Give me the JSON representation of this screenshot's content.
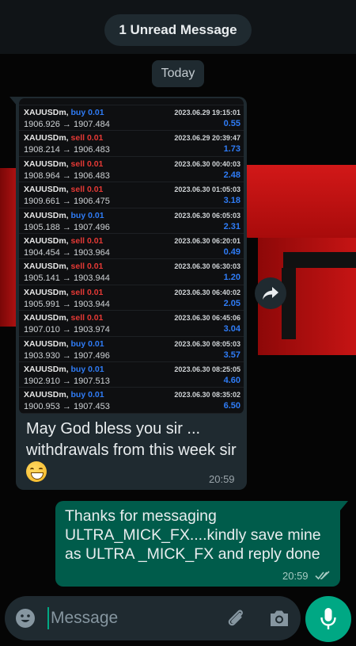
{
  "banner": {
    "unread": "1 Unread Message",
    "date_chip": "Today"
  },
  "incoming": {
    "trades": [
      {
        "symbol": "XAUUSDm,",
        "direction": "buy",
        "lot": "0.01",
        "prices": "1906.926 → 1907.484",
        "date": "2023.06.29 19:15:01",
        "profit": "0.55"
      },
      {
        "symbol": "XAUUSDm,",
        "direction": "sell",
        "lot": "0.01",
        "prices": "1908.214 → 1906.483",
        "date": "2023.06.29 20:39:47",
        "profit": "1.73"
      },
      {
        "symbol": "XAUUSDm,",
        "direction": "sell",
        "lot": "0.01",
        "prices": "1908.964 → 1906.483",
        "date": "2023.06.30 00:40:03",
        "profit": "2.48"
      },
      {
        "symbol": "XAUUSDm,",
        "direction": "sell",
        "lot": "0.01",
        "prices": "1909.661 → 1906.475",
        "date": "2023.06.30 01:05:03",
        "profit": "3.18"
      },
      {
        "symbol": "XAUUSDm,",
        "direction": "buy",
        "lot": "0.01",
        "prices": "1905.188 → 1907.496",
        "date": "2023.06.30 06:05:03",
        "profit": "2.31"
      },
      {
        "symbol": "XAUUSDm,",
        "direction": "sell",
        "lot": "0.01",
        "prices": "1904.454 → 1903.964",
        "date": "2023.06.30 06:20:01",
        "profit": "0.49"
      },
      {
        "symbol": "XAUUSDm,",
        "direction": "sell",
        "lot": "0.01",
        "prices": "1905.141 → 1903.944",
        "date": "2023.06.30 06:30:03",
        "profit": "1.20"
      },
      {
        "symbol": "XAUUSDm,",
        "direction": "sell",
        "lot": "0.01",
        "prices": "1905.991 → 1903.944",
        "date": "2023.06.30 06:40:02",
        "profit": "2.05"
      },
      {
        "symbol": "XAUUSDm,",
        "direction": "sell",
        "lot": "0.01",
        "prices": "1907.010 → 1903.974",
        "date": "2023.06.30 06:45:06",
        "profit": "3.04"
      },
      {
        "symbol": "XAUUSDm,",
        "direction": "buy",
        "lot": "0.01",
        "prices": "1903.930 → 1907.496",
        "date": "2023.06.30 08:05:03",
        "profit": "3.57"
      },
      {
        "symbol": "XAUUSDm,",
        "direction": "buy",
        "lot": "0.01",
        "prices": "1902.910 → 1907.513",
        "date": "2023.06.30 08:25:05",
        "profit": "4.60"
      },
      {
        "symbol": "XAUUSDm,",
        "direction": "buy",
        "lot": "0.01",
        "prices": "1900.953 → 1907.453",
        "date": "2023.06.30 08:35:02",
        "profit": "6.50"
      }
    ],
    "text": "May God bless you sir ... withdrawals from this week sir",
    "time": "20:59"
  },
  "outgoing": {
    "text": "Thanks for messaging ULTRA_MICK_FX....kindly save mine as ULTRA _MICK_FX and reply done",
    "time": "20:59"
  },
  "composer": {
    "placeholder": "Message"
  },
  "colors": {
    "accent": "#00a884",
    "outgoing_bubble": "#005c4b",
    "incoming_bubble": "#1f2a30",
    "buy": "#2f7cf6",
    "sell": "#e53935"
  },
  "icons": [
    "forward-icon",
    "emoji-icon",
    "attach-icon",
    "camera-icon",
    "mic-icon",
    "double-check-icon"
  ]
}
